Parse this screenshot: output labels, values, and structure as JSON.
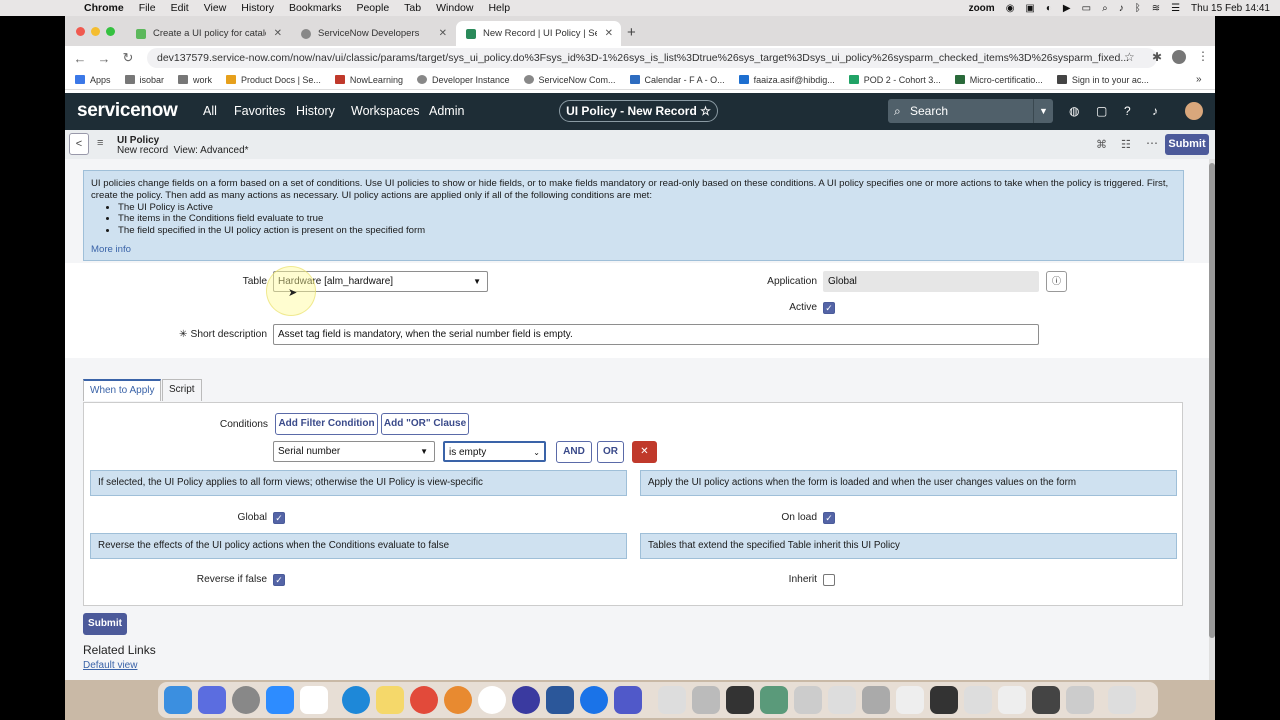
{
  "mac_menu": {
    "app": "Chrome",
    "items": [
      "File",
      "Edit",
      "View",
      "History",
      "Bookmarks",
      "People",
      "Tab",
      "Window",
      "Help"
    ],
    "zoom_label": "zoom",
    "datetime": "Thu 15 Feb  14:41"
  },
  "tabs": [
    {
      "title": "Create a UI policy for catalog it",
      "color": "#5cb85c"
    },
    {
      "title": "ServiceNow Developers",
      "color": "#888"
    },
    {
      "title": "New Record | UI Policy | Servic",
      "color": "#2a8a5a"
    }
  ],
  "address": {
    "url": "dev137579.service-now.com/now/nav/ui/classic/params/target/sys_ui_policy.do%3Fsys_id%3D-1%26sys_is_list%3Dtrue%26sys_target%3Dsys_ui_policy%26sysparm_checked_items%3D%26sysparm_fixed..."
  },
  "bookmarks": [
    "Apps",
    "isobar",
    "work",
    "Product Docs | Se...",
    "NowLearning",
    "Developer Instance",
    "ServiceNow Com...",
    "Calendar - F A - O...",
    "faaiza.asif@hibdig...",
    "POD 2 - Cohort 3...",
    "Micro-certificatio...",
    "Sign in to your ac..."
  ],
  "snheader": {
    "logo_a": "service",
    "logo_b": "now",
    "nav": [
      "All",
      "Favorites",
      "History",
      "Workspaces",
      "Admin"
    ],
    "context_pill": "UI Policy - New Record  ☆",
    "search_placeholder": "Search"
  },
  "formheader": {
    "title": "UI Policy",
    "subtitle": "New record  View: Advanced*",
    "submit": "Submit"
  },
  "info": {
    "text": "UI policies change fields on a form based on a set of conditions. Use UI policies to show or hide fields, or to make fields mandatory or read-only based on these conditions. A UI policy specifies one or more actions to take when the policy is triggered. First, create the policy. Then add as many actions as necessary. UI policy actions are applied only if all of the following conditions are met:",
    "bullets": [
      "The UI Policy is Active",
      "The items in the Conditions field evaluate to true",
      "The field specified in the UI policy action is present on the specified form"
    ],
    "more": "More info"
  },
  "form": {
    "table_label": "Table",
    "table_value": "Hardware [alm_hardware]",
    "application_label": "Application",
    "application_value": "Global",
    "active_label": "Active",
    "shortdesc_label": "Short description",
    "shortdesc_value": "Asset tag field is mandatory, when the serial number field is empty."
  },
  "tabs_form": {
    "when": "When to Apply",
    "script": "Script"
  },
  "conditions": {
    "label": "Conditions",
    "add_filter": "Add Filter Condition",
    "add_or": "Add \"OR\" Clause",
    "field": "Serial number",
    "operator": "is empty",
    "and": "AND",
    "or": "OR"
  },
  "help": {
    "global": "If selected, the UI Policy applies to all form views; otherwise the UI Policy is view-specific",
    "onload": "Apply the UI policy actions when the form is loaded and when the user changes values on the form",
    "reverse": "Reverse the effects of the UI policy actions when the Conditions evaluate to false",
    "inherit": "Tables that extend the specified Table inherit this UI Policy"
  },
  "options": {
    "global": "Global",
    "onload": "On load",
    "reverse": "Reverse if false",
    "inherit": "Inherit"
  },
  "bottom": {
    "submit": "Submit",
    "related": "Related Links",
    "default_view": "Default view"
  }
}
